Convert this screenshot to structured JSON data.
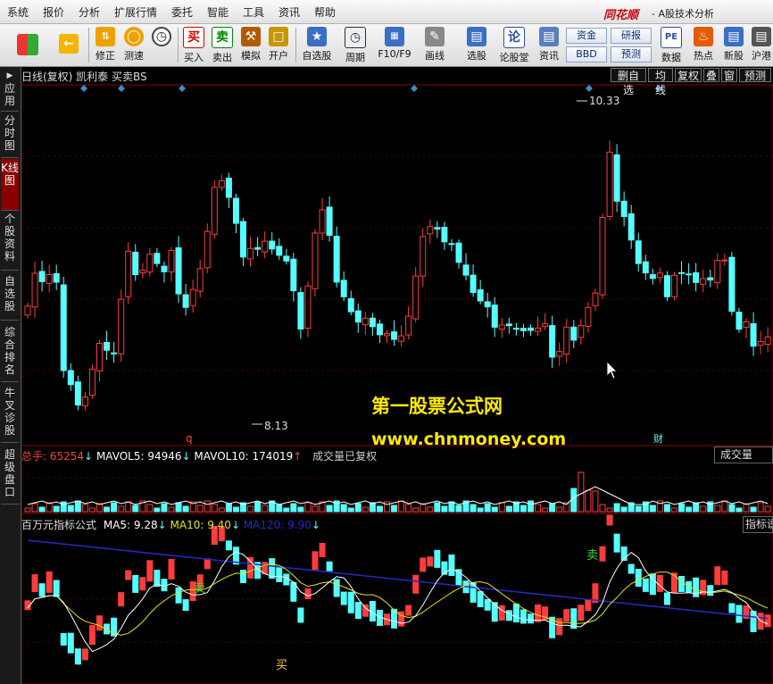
{
  "menu": [
    "系统",
    "报价",
    "分析",
    "扩展行情",
    "委托",
    "智能",
    "工具",
    "资讯",
    "帮助"
  ],
  "brand": "同花顺",
  "app_title": "- A股技术分析",
  "toolbar": {
    "buttons": [
      {
        "label": "",
        "icon": "color-squares-icon"
      },
      {
        "label": "",
        "icon": "back-arrow-icon"
      },
      {
        "label": "修正",
        "icon": "up-down-arrows-icon"
      },
      {
        "label": "测速",
        "icon": "speed-test-icon"
      },
      {
        "label": "买入",
        "icon": "buy-icon"
      },
      {
        "label": "卖出",
        "icon": "sell-icon"
      },
      {
        "label": "模拟",
        "icon": "hammer-icon"
      },
      {
        "label": "开户",
        "icon": "lock-icon"
      },
      {
        "label": "自选股",
        "icon": "star-icon"
      },
      {
        "label": "周期",
        "icon": "clock-icon"
      },
      {
        "label": "F10/F9",
        "icon": "f10-icon"
      },
      {
        "label": "画线",
        "icon": "pencil-icon"
      },
      {
        "label": "选股",
        "icon": "stock-select-icon"
      },
      {
        "label": "论股堂",
        "icon": "forum-icon"
      },
      {
        "label": "资讯",
        "icon": "news-icon"
      },
      {
        "label": "数据",
        "icon": "data-pe-icon"
      },
      {
        "label": "热点",
        "icon": "hot-icon"
      },
      {
        "label": "新股",
        "icon": "new-stock-icon"
      },
      {
        "label": "沪港",
        "icon": "hk-connect-icon"
      }
    ],
    "buy_glyph": "买",
    "sell_glyph": "卖",
    "forum_glyph": "论",
    "pe_glyph": "PE",
    "mini_buttons": [
      "资金",
      "研报",
      "BBD",
      "预测"
    ]
  },
  "sidebar": [
    "应用",
    "分时图",
    "K线图",
    "个股资料",
    "自选股",
    "综合排名",
    "牛叉诊股",
    "超级盘口"
  ],
  "price_panel": {
    "header": "日线(复权)  凯利泰  买卖BS",
    "buttons": [
      "删自选",
      "均线",
      "复权",
      "叠",
      "窗",
      "预测"
    ],
    "high_label": "10.33",
    "low_label": "8.13",
    "marker_q": "q",
    "marker_cai": "财"
  },
  "volume_panel": {
    "total_label": "总手: 65254",
    "mavol5": "MAVOL5: 94946",
    "mavol10": "MAVOL10: 174019",
    "note": "成交量已复权",
    "right_button": "成交量"
  },
  "indicator_panel": {
    "name": "百万元指标公式",
    "ma5": "MA5: 9.28",
    "ma10": "MA10: 9.40",
    "ma120": "MA120: 9.90",
    "right_button": "指标说",
    "sell_signal": "卖",
    "buy_signal": "买"
  },
  "watermark": {
    "line1": "第一股票公式网",
    "line2": "www.chnmoney.com"
  },
  "colors": {
    "up": "#ff3c3c",
    "down": "#54ffff",
    "ma120": "#2828c8",
    "ma5": "#ffffff",
    "ma10": "#e6e600",
    "accent": "#ffea00"
  }
}
